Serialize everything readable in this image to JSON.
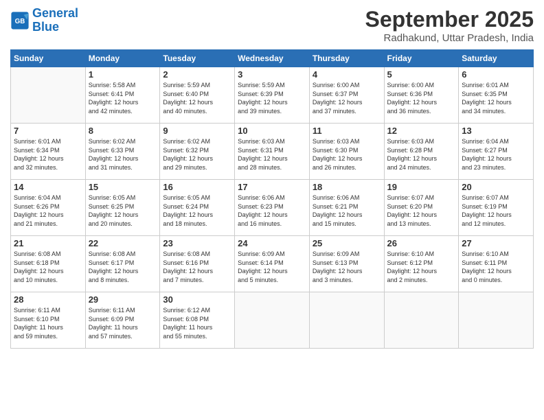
{
  "logo": {
    "line1": "General",
    "line2": "Blue"
  },
  "title": "September 2025",
  "location": "Radhakund, Uttar Pradesh, India",
  "days_header": [
    "Sunday",
    "Monday",
    "Tuesday",
    "Wednesday",
    "Thursday",
    "Friday",
    "Saturday"
  ],
  "weeks": [
    [
      {
        "day": "",
        "info": ""
      },
      {
        "day": "1",
        "info": "Sunrise: 5:58 AM\nSunset: 6:41 PM\nDaylight: 12 hours\nand 42 minutes."
      },
      {
        "day": "2",
        "info": "Sunrise: 5:59 AM\nSunset: 6:40 PM\nDaylight: 12 hours\nand 40 minutes."
      },
      {
        "day": "3",
        "info": "Sunrise: 5:59 AM\nSunset: 6:39 PM\nDaylight: 12 hours\nand 39 minutes."
      },
      {
        "day": "4",
        "info": "Sunrise: 6:00 AM\nSunset: 6:37 PM\nDaylight: 12 hours\nand 37 minutes."
      },
      {
        "day": "5",
        "info": "Sunrise: 6:00 AM\nSunset: 6:36 PM\nDaylight: 12 hours\nand 36 minutes."
      },
      {
        "day": "6",
        "info": "Sunrise: 6:01 AM\nSunset: 6:35 PM\nDaylight: 12 hours\nand 34 minutes."
      }
    ],
    [
      {
        "day": "7",
        "info": "Sunrise: 6:01 AM\nSunset: 6:34 PM\nDaylight: 12 hours\nand 32 minutes."
      },
      {
        "day": "8",
        "info": "Sunrise: 6:02 AM\nSunset: 6:33 PM\nDaylight: 12 hours\nand 31 minutes."
      },
      {
        "day": "9",
        "info": "Sunrise: 6:02 AM\nSunset: 6:32 PM\nDaylight: 12 hours\nand 29 minutes."
      },
      {
        "day": "10",
        "info": "Sunrise: 6:03 AM\nSunset: 6:31 PM\nDaylight: 12 hours\nand 28 minutes."
      },
      {
        "day": "11",
        "info": "Sunrise: 6:03 AM\nSunset: 6:30 PM\nDaylight: 12 hours\nand 26 minutes."
      },
      {
        "day": "12",
        "info": "Sunrise: 6:03 AM\nSunset: 6:28 PM\nDaylight: 12 hours\nand 24 minutes."
      },
      {
        "day": "13",
        "info": "Sunrise: 6:04 AM\nSunset: 6:27 PM\nDaylight: 12 hours\nand 23 minutes."
      }
    ],
    [
      {
        "day": "14",
        "info": "Sunrise: 6:04 AM\nSunset: 6:26 PM\nDaylight: 12 hours\nand 21 minutes."
      },
      {
        "day": "15",
        "info": "Sunrise: 6:05 AM\nSunset: 6:25 PM\nDaylight: 12 hours\nand 20 minutes."
      },
      {
        "day": "16",
        "info": "Sunrise: 6:05 AM\nSunset: 6:24 PM\nDaylight: 12 hours\nand 18 minutes."
      },
      {
        "day": "17",
        "info": "Sunrise: 6:06 AM\nSunset: 6:23 PM\nDaylight: 12 hours\nand 16 minutes."
      },
      {
        "day": "18",
        "info": "Sunrise: 6:06 AM\nSunset: 6:21 PM\nDaylight: 12 hours\nand 15 minutes."
      },
      {
        "day": "19",
        "info": "Sunrise: 6:07 AM\nSunset: 6:20 PM\nDaylight: 12 hours\nand 13 minutes."
      },
      {
        "day": "20",
        "info": "Sunrise: 6:07 AM\nSunset: 6:19 PM\nDaylight: 12 hours\nand 12 minutes."
      }
    ],
    [
      {
        "day": "21",
        "info": "Sunrise: 6:08 AM\nSunset: 6:18 PM\nDaylight: 12 hours\nand 10 minutes."
      },
      {
        "day": "22",
        "info": "Sunrise: 6:08 AM\nSunset: 6:17 PM\nDaylight: 12 hours\nand 8 minutes."
      },
      {
        "day": "23",
        "info": "Sunrise: 6:08 AM\nSunset: 6:16 PM\nDaylight: 12 hours\nand 7 minutes."
      },
      {
        "day": "24",
        "info": "Sunrise: 6:09 AM\nSunset: 6:14 PM\nDaylight: 12 hours\nand 5 minutes."
      },
      {
        "day": "25",
        "info": "Sunrise: 6:09 AM\nSunset: 6:13 PM\nDaylight: 12 hours\nand 3 minutes."
      },
      {
        "day": "26",
        "info": "Sunrise: 6:10 AM\nSunset: 6:12 PM\nDaylight: 12 hours\nand 2 minutes."
      },
      {
        "day": "27",
        "info": "Sunrise: 6:10 AM\nSunset: 6:11 PM\nDaylight: 12 hours\nand 0 minutes."
      }
    ],
    [
      {
        "day": "28",
        "info": "Sunrise: 6:11 AM\nSunset: 6:10 PM\nDaylight: 11 hours\nand 59 minutes."
      },
      {
        "day": "29",
        "info": "Sunrise: 6:11 AM\nSunset: 6:09 PM\nDaylight: 11 hours\nand 57 minutes."
      },
      {
        "day": "30",
        "info": "Sunrise: 6:12 AM\nSunset: 6:08 PM\nDaylight: 11 hours\nand 55 minutes."
      },
      {
        "day": "",
        "info": ""
      },
      {
        "day": "",
        "info": ""
      },
      {
        "day": "",
        "info": ""
      },
      {
        "day": "",
        "info": ""
      }
    ]
  ]
}
